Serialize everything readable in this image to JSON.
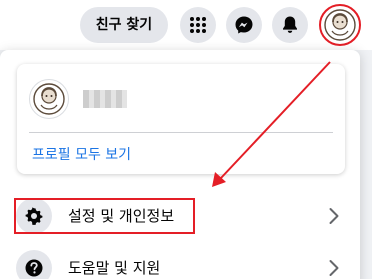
{
  "header": {
    "find_friends_label": "친구 찾기",
    "icons": [
      "menu-grid-icon",
      "messenger-icon",
      "bell-icon",
      "profile-avatar"
    ]
  },
  "dropdown": {
    "profile_link": "프로필 모두 보기",
    "menu": [
      {
        "label": "설정 및 개인정보",
        "icon": "gear-icon"
      },
      {
        "label": "도움말 및 지원",
        "icon": "help-icon"
      }
    ]
  },
  "colors": {
    "annotation": "#e41e26",
    "link": "#1b74e4"
  }
}
